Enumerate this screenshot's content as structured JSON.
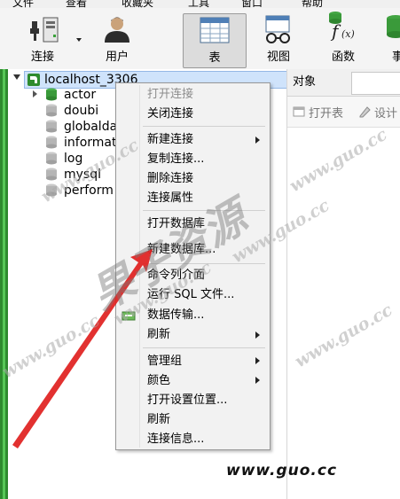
{
  "menubar": {
    "items": [
      "文件",
      "查看",
      "收藏夹",
      "工具",
      "窗口",
      "帮助"
    ]
  },
  "toolbar": {
    "connect_label": "连接",
    "user_label": "用户",
    "table_label": "表",
    "view_label": "视图",
    "function_label": "函数",
    "partial_label": "事"
  },
  "tree": {
    "connection": "localhost_3306",
    "databases": [
      "actor",
      "doubi",
      "globalda",
      "informat",
      "log",
      "mysql",
      "perform"
    ]
  },
  "right_pane": {
    "tab_label": "对象",
    "open_table_label": "打开表",
    "design_label": "设计"
  },
  "context_menu": {
    "items": [
      {
        "label": "打开连接",
        "disabled": true
      },
      {
        "label": "关闭连接"
      },
      {
        "label": "新建连接",
        "submenu": true
      },
      {
        "label": "复制连接..."
      },
      {
        "label": "删除连接"
      },
      {
        "label": "连接属性"
      },
      {
        "label": "打开数据库"
      },
      {
        "label": "新建数据库..."
      },
      {
        "label": "命令列介面"
      },
      {
        "label": "运行 SQL 文件..."
      },
      {
        "label": "数据传输..."
      },
      {
        "label": "刷新",
        "submenu": true
      },
      {
        "label": "管理组",
        "submenu": true
      },
      {
        "label": "颜色",
        "submenu": true
      },
      {
        "label": "打开设置位置..."
      },
      {
        "label": "刷新"
      },
      {
        "label": "连接信息..."
      }
    ]
  },
  "watermark": {
    "url": "www.guo.cc",
    "cn_text": "果子资源"
  },
  "brand_text": "www.guo.cc"
}
